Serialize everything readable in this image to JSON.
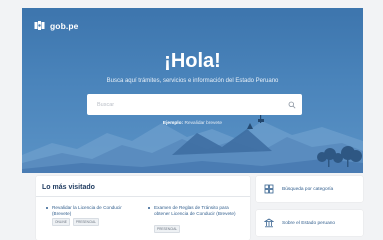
{
  "brand": {
    "logo_text": "gob.pe"
  },
  "hero": {
    "greeting": "¡Hola!",
    "tagline": "Busca aquí trámites, servicios e información del Estado Peruano"
  },
  "search": {
    "placeholder": "Buscar"
  },
  "example": {
    "prefix": "Ejemplo:",
    "link": "Revalidar brevete"
  },
  "most_visited": {
    "title": "Lo más visitado",
    "items": [
      {
        "title": "Revalidar la Licencia de Conducir (Brevete)",
        "tags": [
          "ONLINE",
          "PRESENCIAL"
        ]
      },
      {
        "title": "Examen de Reglas de Tránsito para obtener Licencia de Conducir (Brevete)",
        "tags": [
          "PRESENCIAL"
        ]
      }
    ]
  },
  "side_links": [
    {
      "label": "Búsqueda por categoría",
      "icon": "grid-icon"
    },
    {
      "label": "Sobre el Estado peruano",
      "icon": "building-icon"
    }
  ]
}
